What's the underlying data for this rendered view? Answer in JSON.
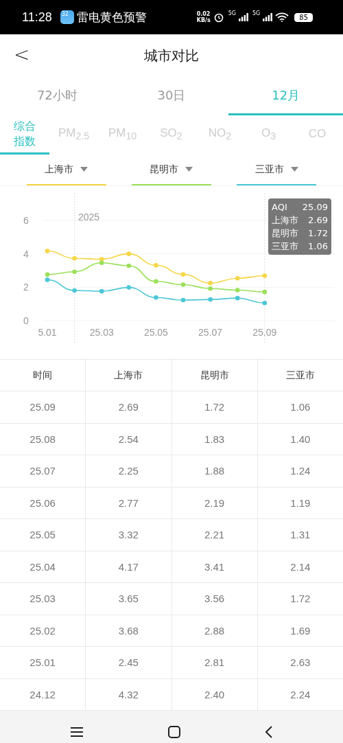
{
  "status_bar": {
    "time": "11:28",
    "notification": "雷电黄色预警",
    "app_badge": "32",
    "speed": "0.02",
    "speed_unit": "KB/s",
    "net1": "5G",
    "net2": "5G",
    "battery": "85"
  },
  "header": {
    "back": "<",
    "title": "城市对比"
  },
  "period_tabs": [
    {
      "label": "72小时",
      "selected": false
    },
    {
      "label": "30日",
      "selected": false
    },
    {
      "label": "12月",
      "selected": true
    }
  ],
  "pollutant_tabs": [
    {
      "label": "综合指数",
      "selected": true
    },
    {
      "label": "PM$_{2.5}$",
      "selected": false
    },
    {
      "label": "PM$_{10}$",
      "selected": false
    },
    {
      "label": "SO$_{2}$",
      "selected": false
    },
    {
      "label": "NO$_{2}$",
      "selected": false
    },
    {
      "label": "O$_{3}$",
      "selected": false
    },
    {
      "label": "CO",
      "selected": false
    }
  ],
  "cities": [
    {
      "name": "上海市",
      "color": "#f5d646"
    },
    {
      "name": "昆明市",
      "color": "#9be05a"
    },
    {
      "name": "三亚市",
      "color": "#4cc6d6"
    }
  ],
  "chart": {
    "chart_data": {
      "type": "line",
      "categories": [
        "5.01",
        null,
        "25.03",
        null,
        "25.05",
        null,
        "25.07",
        null,
        "25.09"
      ],
      "series": [
        {
          "color": "#f5d646",
          "marker": true,
          "values": [
            4.17,
            3.73,
            3.68,
            4.0,
            3.32,
            2.77,
            2.25,
            2.54,
            2.69
          ]
        },
        {
          "color": "#9be05a",
          "marker": true,
          "values": [
            2.76,
            2.93,
            3.46,
            3.29,
            2.35,
            2.16,
            1.92,
            1.83,
            1.72
          ]
        },
        {
          "color": "#4cc6d6",
          "marker": true,
          "values": [
            2.45,
            1.81,
            1.76,
            1.99,
            1.39,
            1.23,
            1.27,
            1.35,
            1.06
          ]
        }
      ],
      "ylim": [
        0,
        6
      ],
      "yticks": [
        0,
        2,
        4,
        6
      ],
      "grid": true,
      "annotations": [
        "2025"
      ]
    },
    "tooltip": {
      "rows": [
        {
          "label": "AQI",
          "value": "25.09"
        },
        {
          "label": "上海市",
          "value": "2.69"
        },
        {
          "label": "昆明市",
          "value": "1.72"
        },
        {
          "label": "三亚市",
          "value": "1.06"
        }
      ]
    }
  },
  "table": {
    "columns": [
      "时间",
      "上海市",
      "昆明市",
      "三亚市"
    ],
    "rows": [
      [
        "25.09",
        "2.69",
        "1.72",
        "1.06"
      ],
      [
        "25.08",
        "2.54",
        "1.83",
        "1.40"
      ],
      [
        "25.07",
        "2.25",
        "1.88",
        "1.24"
      ],
      [
        "25.06",
        "2.77",
        "2.19",
        "1.19"
      ],
      [
        "25.05",
        "3.32",
        "2.21",
        "1.31"
      ],
      [
        "25.04",
        "4.17",
        "3.41",
        "2.14"
      ],
      [
        "25.03",
        "3.65",
        "3.56",
        "1.72"
      ],
      [
        "25.02",
        "3.68",
        "2.88",
        "1.69"
      ],
      [
        "25.01",
        "2.45",
        "2.81",
        "2.63"
      ],
      [
        "24.12",
        "4.32",
        "2.40",
        "2.24"
      ]
    ]
  }
}
